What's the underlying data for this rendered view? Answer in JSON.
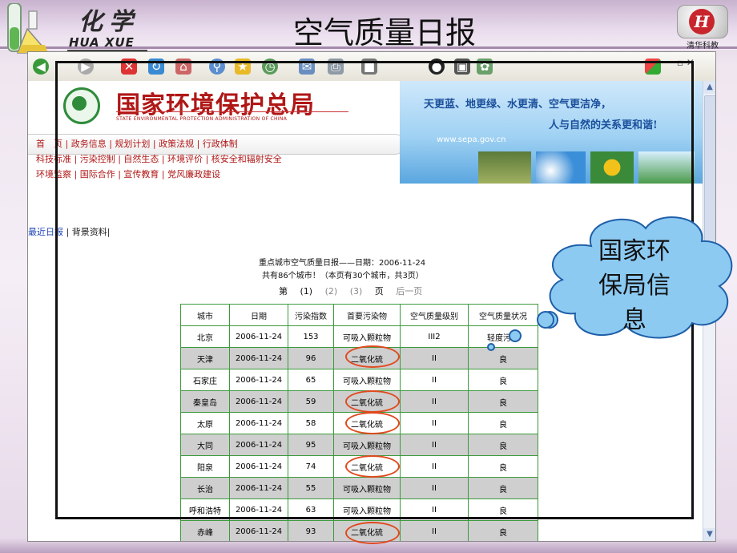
{
  "slide": {
    "brand_cn": "化学",
    "brand_en": "HUA XUE",
    "title": "空气质量日报",
    "logo_text": "清华科教"
  },
  "site": {
    "agency_cn": "国家环境保护总局",
    "agency_en": "STATE ENVIRONMENTAL PROTECTION ADMINISTRATION OF CHINA",
    "slogan_line1": "天更蓝、地更绿、水更清、空气更洁净，",
    "slogan_line2": "人与自然的关系更和谐!",
    "website": "www.sepa.gov.cn",
    "nav_row1": "首　页 | 政务信息 | 规划计划 | 政策法规 | 行政体制",
    "nav_row2": "科技标准 | 污染控制 | 自然生态 | 环境评价 | 核安全和辐射安全",
    "nav_row3": "环境监察 | 国际合作 | 宣传教育 | 党风廉政建设"
  },
  "subnav": {
    "active": "最近日报",
    "other": "| 背景资料|"
  },
  "report": {
    "title": "重点城市空气质量日报——日期：2006-11-24",
    "count": "共有86个城市！（本页有30个城市，共3页）",
    "pager": {
      "label_page": "第",
      "p1": "(1)",
      "p2": "(2)",
      "p3": "(3)",
      "label_page_end": "页",
      "next": "后一页"
    },
    "headers": [
      "城市",
      "日期",
      "污染指数",
      "首要污染物",
      "空气质量级别",
      "空气质量状况"
    ],
    "rows": [
      [
        "北京",
        "2006-11-24",
        "153",
        "可吸入颗粒物",
        "III2",
        "轻度污染"
      ],
      [
        "天津",
        "2006-11-24",
        "96",
        "二氧化硫",
        "II",
        "良"
      ],
      [
        "石家庄",
        "2006-11-24",
        "65",
        "可吸入颗粒物",
        "II",
        "良"
      ],
      [
        "秦皇岛",
        "2006-11-24",
        "59",
        "二氧化硫",
        "II",
        "良"
      ],
      [
        "太原",
        "2006-11-24",
        "58",
        "二氧化硫",
        "II",
        "良"
      ],
      [
        "大同",
        "2006-11-24",
        "95",
        "可吸入颗粒物",
        "II",
        "良"
      ],
      [
        "阳泉",
        "2006-11-24",
        "74",
        "二氧化硫",
        "II",
        "良"
      ],
      [
        "长治",
        "2006-11-24",
        "55",
        "可吸入颗粒物",
        "II",
        "良"
      ],
      [
        "呼和浩特",
        "2006-11-24",
        "63",
        "可吸入颗粒物",
        "II",
        "良"
      ],
      [
        "赤峰",
        "2006-11-24",
        "93",
        "二氧化硫",
        "II",
        "良"
      ]
    ]
  },
  "callout": {
    "text_line1": "国家环",
    "text_line2": "保局信",
    "text_line3": "息"
  },
  "colors": {
    "agency_red": "#b01717",
    "table_border": "#3c9a3c",
    "highlight_ring": "#e0491e",
    "callout_fill": "#8ccaf2",
    "callout_stroke": "#1f5fa8"
  },
  "icons": [
    "back-icon",
    "forward-icon",
    "stop-icon",
    "refresh-icon",
    "home-icon",
    "search-icon",
    "favorites-icon",
    "history-icon",
    "mail-icon",
    "print-icon",
    "edit-icon",
    "messenger-icon",
    "windows-logo-icon"
  ]
}
